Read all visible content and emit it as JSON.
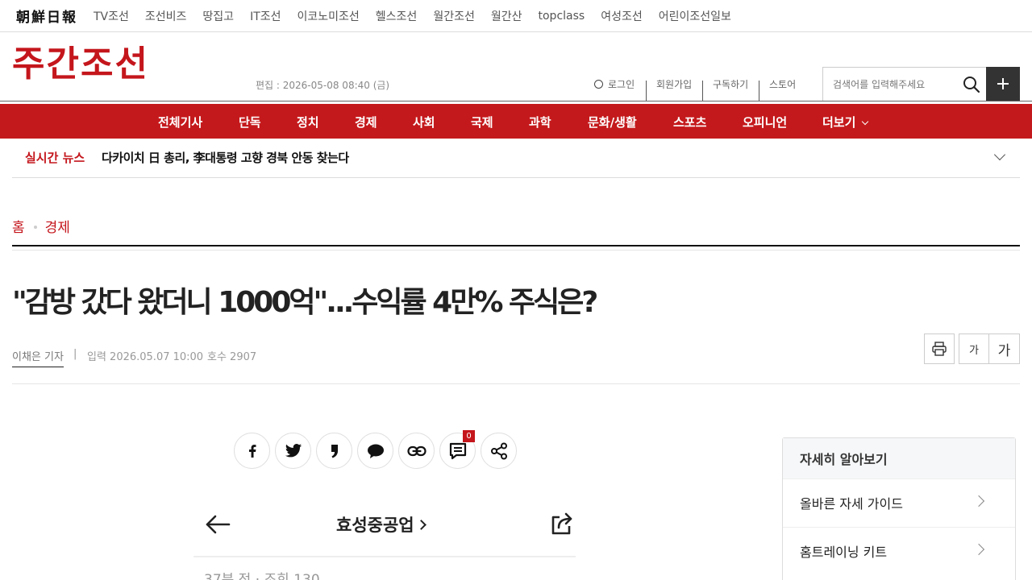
{
  "topbar": {
    "logo": "朝鮮日報",
    "links": [
      "TV조선",
      "조선비즈",
      "땅집고",
      "IT조선",
      "이코노미조선",
      "헬스조선",
      "월간조선",
      "월간산",
      "topclass",
      "여성조선",
      "어린이조선일보"
    ]
  },
  "header": {
    "brand": "주간조선",
    "edit_date": "편집 : 2026-05-08 08:40 (금)",
    "login": "로그인",
    "join": "회원가입",
    "subscribe": "구독하기",
    "store": "스토어",
    "search_placeholder": "검색어를 입력해주세요"
  },
  "nav": {
    "items": [
      "전체기사",
      "단독",
      "정치",
      "경제",
      "사회",
      "국제",
      "과학",
      "문화/생활",
      "스포츠",
      "오피니언",
      "더보기"
    ]
  },
  "live_news": {
    "label": "실시간 뉴스",
    "headline": "다카이치 日 총리, 李대통령 고향 경북 안동 찾는다"
  },
  "breadcrumb": {
    "home": "홈",
    "section": "경제"
  },
  "article": {
    "title": "\"감방 갔다 왔더니 1000억\"...수익률 4만% 주식은?",
    "author": "이채은 기자",
    "separator": "|",
    "published": "입력 2026.05.07 10:00",
    "issue": "호수 2907",
    "font_small": "가",
    "font_large": "가",
    "comment_count": "0"
  },
  "article_image": {
    "title": "효성중공업",
    "meta": "37분 전 · 조회 130"
  },
  "sidebar": {
    "heading": "자세히 알아보기",
    "items": [
      "올바른 자세 가이드",
      "홈트레이닝 키트"
    ]
  },
  "colors": {
    "brand_red": "#c4161c",
    "nav_red": "#c4191c",
    "dark_button": "#333333"
  }
}
